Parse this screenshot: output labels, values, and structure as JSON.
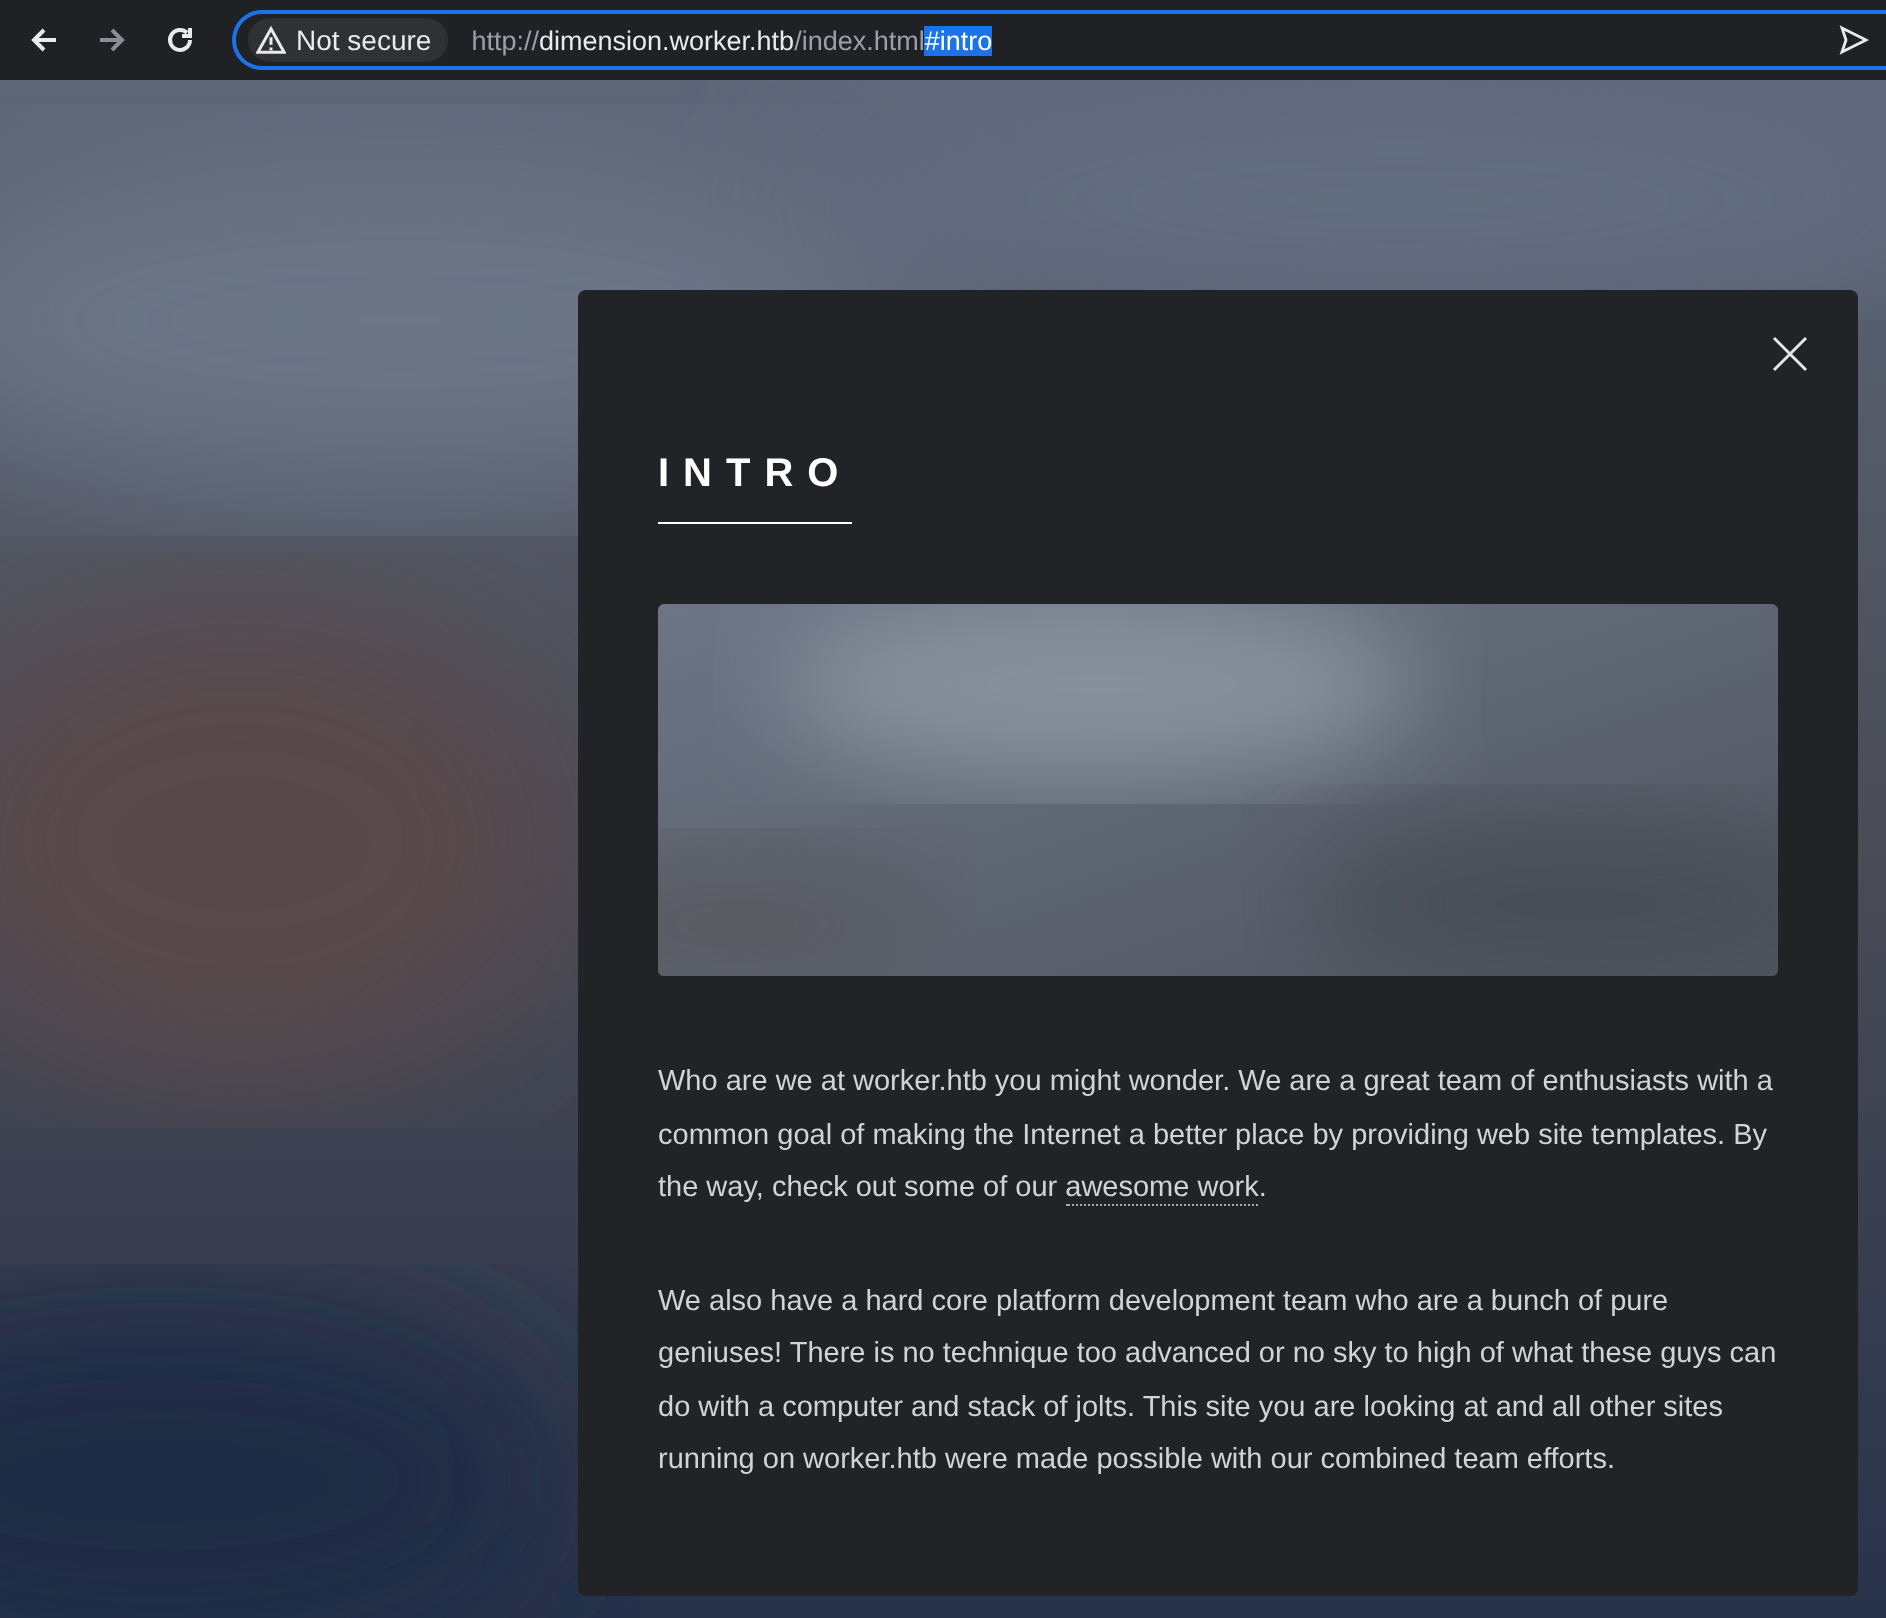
{
  "browser": {
    "url": [
      {
        "kind": "scheme",
        "text": "http://",
        "selected": false
      },
      {
        "kind": "host",
        "text": "dimension.worker.htb",
        "selected": false
      },
      {
        "kind": "path",
        "text": "/index.html",
        "selected": false
      },
      {
        "kind": "fragment",
        "text": "#intro",
        "selected": true
      }
    ],
    "security": "Not secure"
  },
  "background": {
    "kind": "picture"
  },
  "panel": {
    "title": "INTRO",
    "image": {
      "kind": "picture"
    },
    "paragraphs": [
      [
        {
          "kind": "text",
          "text": "Who are we at worker.htb you might wonder. We are a great team of enthusiasts with a common goal of making the Internet a better place by providing web site templates. By the way, check out some of our "
        },
        {
          "kind": "link",
          "text": "awesome work"
        },
        {
          "kind": "text",
          "text": "."
        }
      ],
      [
        {
          "kind": "text",
          "text": "We also have a hard core platform development team who are a bunch of pure geniuses! There is no technique too advanced or no sky to high of what these guys can do with a computer and stack of jolts. This site you are looking at and all other sites running on worker.htb were made possible with our combined team efforts."
        }
      ]
    ]
  }
}
